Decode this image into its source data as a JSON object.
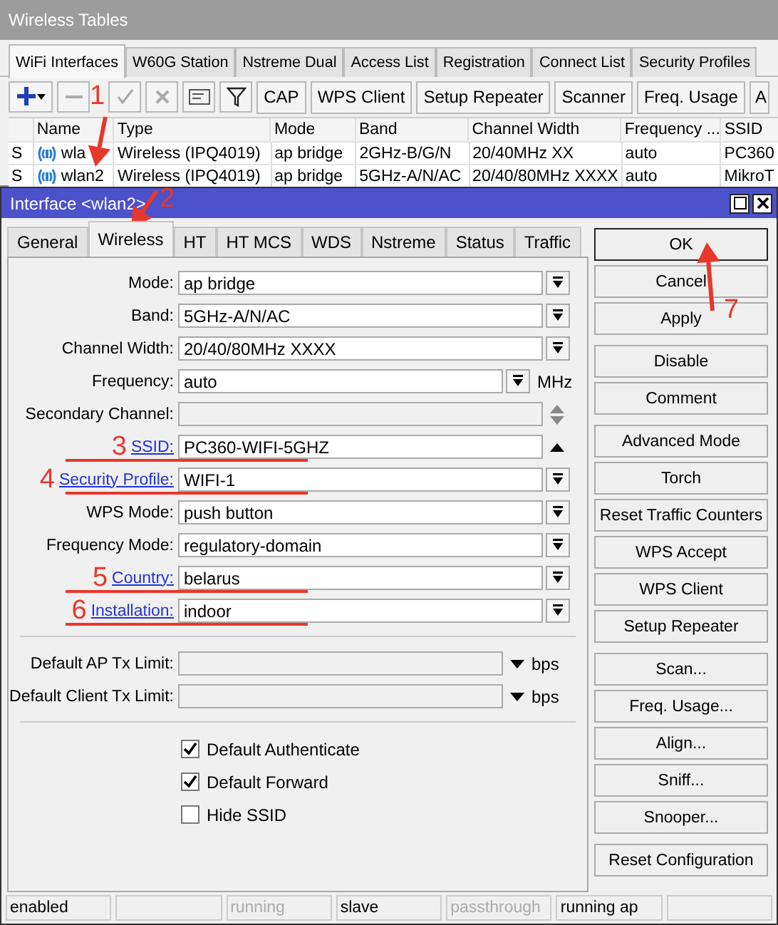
{
  "background_window": {
    "title": "Wireless Tables",
    "tabs": [
      {
        "label": "WiFi Interfaces",
        "selected": true
      },
      {
        "label": "W60G Station",
        "selected": false
      },
      {
        "label": "Nstreme Dual",
        "selected": false
      },
      {
        "label": "Access List",
        "selected": false
      },
      {
        "label": "Registration",
        "selected": false
      },
      {
        "label": "Connect List",
        "selected": false
      },
      {
        "label": "Security Profiles",
        "selected": false
      }
    ],
    "toolbar_buttons": [
      "CAP",
      "WPS Client",
      "Setup Repeater",
      "Scanner",
      "Freq. Usage",
      "A"
    ],
    "table": {
      "columns": [
        "Name",
        "Type",
        "Mode",
        "Band",
        "Channel Width",
        "Frequency ...",
        "SSID"
      ],
      "rows": [
        {
          "flag": "S",
          "cells": [
            "wla",
            "Wireless (IPQ4019)",
            "ap bridge",
            "2GHz-B/G/N",
            "20/40MHz XX",
            "auto",
            "PC360"
          ]
        },
        {
          "flag": "S",
          "cells": [
            "wlan2",
            "Wireless (IPQ4019)",
            "ap bridge",
            "5GHz-A/N/AC",
            "20/40/80MHz XXXX",
            "auto",
            "MikroT"
          ]
        }
      ]
    }
  },
  "dialog": {
    "title": "Interface <wlan2>",
    "tabs": [
      {
        "label": "General",
        "selected": false
      },
      {
        "label": "Wireless",
        "selected": true
      },
      {
        "label": "HT",
        "selected": false
      },
      {
        "label": "HT MCS",
        "selected": false
      },
      {
        "label": "WDS",
        "selected": false
      },
      {
        "label": "Nstreme",
        "selected": false
      },
      {
        "label": "Status",
        "selected": false
      },
      {
        "label": "Traffic",
        "selected": false
      }
    ],
    "fields": [
      {
        "kind": "select",
        "label": "Mode:",
        "value": "ap bridge",
        "link": false
      },
      {
        "kind": "select",
        "label": "Band:",
        "value": "5GHz-A/N/AC",
        "link": false
      },
      {
        "kind": "select",
        "label": "Channel Width:",
        "value": "20/40/80MHz XXXX",
        "link": false
      },
      {
        "kind": "select-unit",
        "label": "Frequency:",
        "value": "auto",
        "unit": "MHz",
        "link": false
      },
      {
        "kind": "disabled",
        "label": "Secondary Channel:",
        "link": false
      },
      {
        "kind": "text",
        "label": "SSID:",
        "value": "PC360-WIFI-5GHZ",
        "link": true,
        "marker": "3"
      },
      {
        "kind": "select",
        "label": "Security Profile:",
        "value": "WIFI-1",
        "link": true,
        "marker": "4"
      },
      {
        "kind": "select",
        "label": "WPS Mode:",
        "value": "push button",
        "link": false
      },
      {
        "kind": "select",
        "label": "Frequency Mode:",
        "value": "regulatory-domain",
        "link": false
      },
      {
        "kind": "select",
        "label": "Country:",
        "value": "belarus",
        "link": true,
        "marker": "5"
      },
      {
        "kind": "select",
        "label": "Installation:",
        "value": "indoor",
        "link": true,
        "marker": "6"
      },
      {
        "kind": "divider"
      },
      {
        "kind": "limit",
        "label": "Default AP Tx Limit:",
        "unit": "bps"
      },
      {
        "kind": "limit",
        "label": "Default Client Tx Limit:",
        "unit": "bps"
      },
      {
        "kind": "divider"
      },
      {
        "kind": "checkbox",
        "label": "Default Authenticate",
        "checked": true
      },
      {
        "kind": "checkbox",
        "label": "Default Forward",
        "checked": true
      },
      {
        "kind": "checkbox",
        "label": "Hide SSID",
        "checked": false
      }
    ],
    "button_groups": [
      [
        {
          "label": "OK",
          "default": true
        },
        {
          "label": "Cancel",
          "default": false
        },
        {
          "label": "Apply",
          "default": false
        }
      ],
      [
        {
          "label": "Disable",
          "default": false
        },
        {
          "label": "Comment",
          "default": false
        }
      ],
      [
        {
          "label": "Advanced Mode",
          "default": false
        },
        {
          "label": "Torch",
          "default": false
        },
        {
          "label": "Reset Traffic Counters",
          "default": false
        },
        {
          "label": "WPS Accept",
          "default": false
        },
        {
          "label": "WPS Client",
          "default": false
        },
        {
          "label": "Setup Repeater",
          "default": false
        }
      ],
      [
        {
          "label": "Scan...",
          "default": false
        },
        {
          "label": "Freq. Usage...",
          "default": false
        },
        {
          "label": "Align...",
          "default": false
        },
        {
          "label": "Sniff...",
          "default": false
        },
        {
          "label": "Snooper...",
          "default": false
        }
      ],
      [
        {
          "label": "Reset Configuration",
          "default": false
        }
      ]
    ],
    "status_bar": [
      {
        "kind": "text",
        "text": "enabled",
        "active": true
      },
      {
        "kind": "empty"
      },
      {
        "kind": "text",
        "text": "running",
        "active": false
      },
      {
        "kind": "text",
        "text": "slave",
        "active": true
      },
      {
        "kind": "text",
        "text": "passthrough",
        "active": false
      },
      {
        "kind": "text",
        "text": "running ap",
        "active": true
      },
      {
        "kind": "empty"
      }
    ]
  },
  "annotations": [
    {
      "label": "1"
    },
    {
      "label": "2"
    },
    {
      "label": "7"
    }
  ]
}
